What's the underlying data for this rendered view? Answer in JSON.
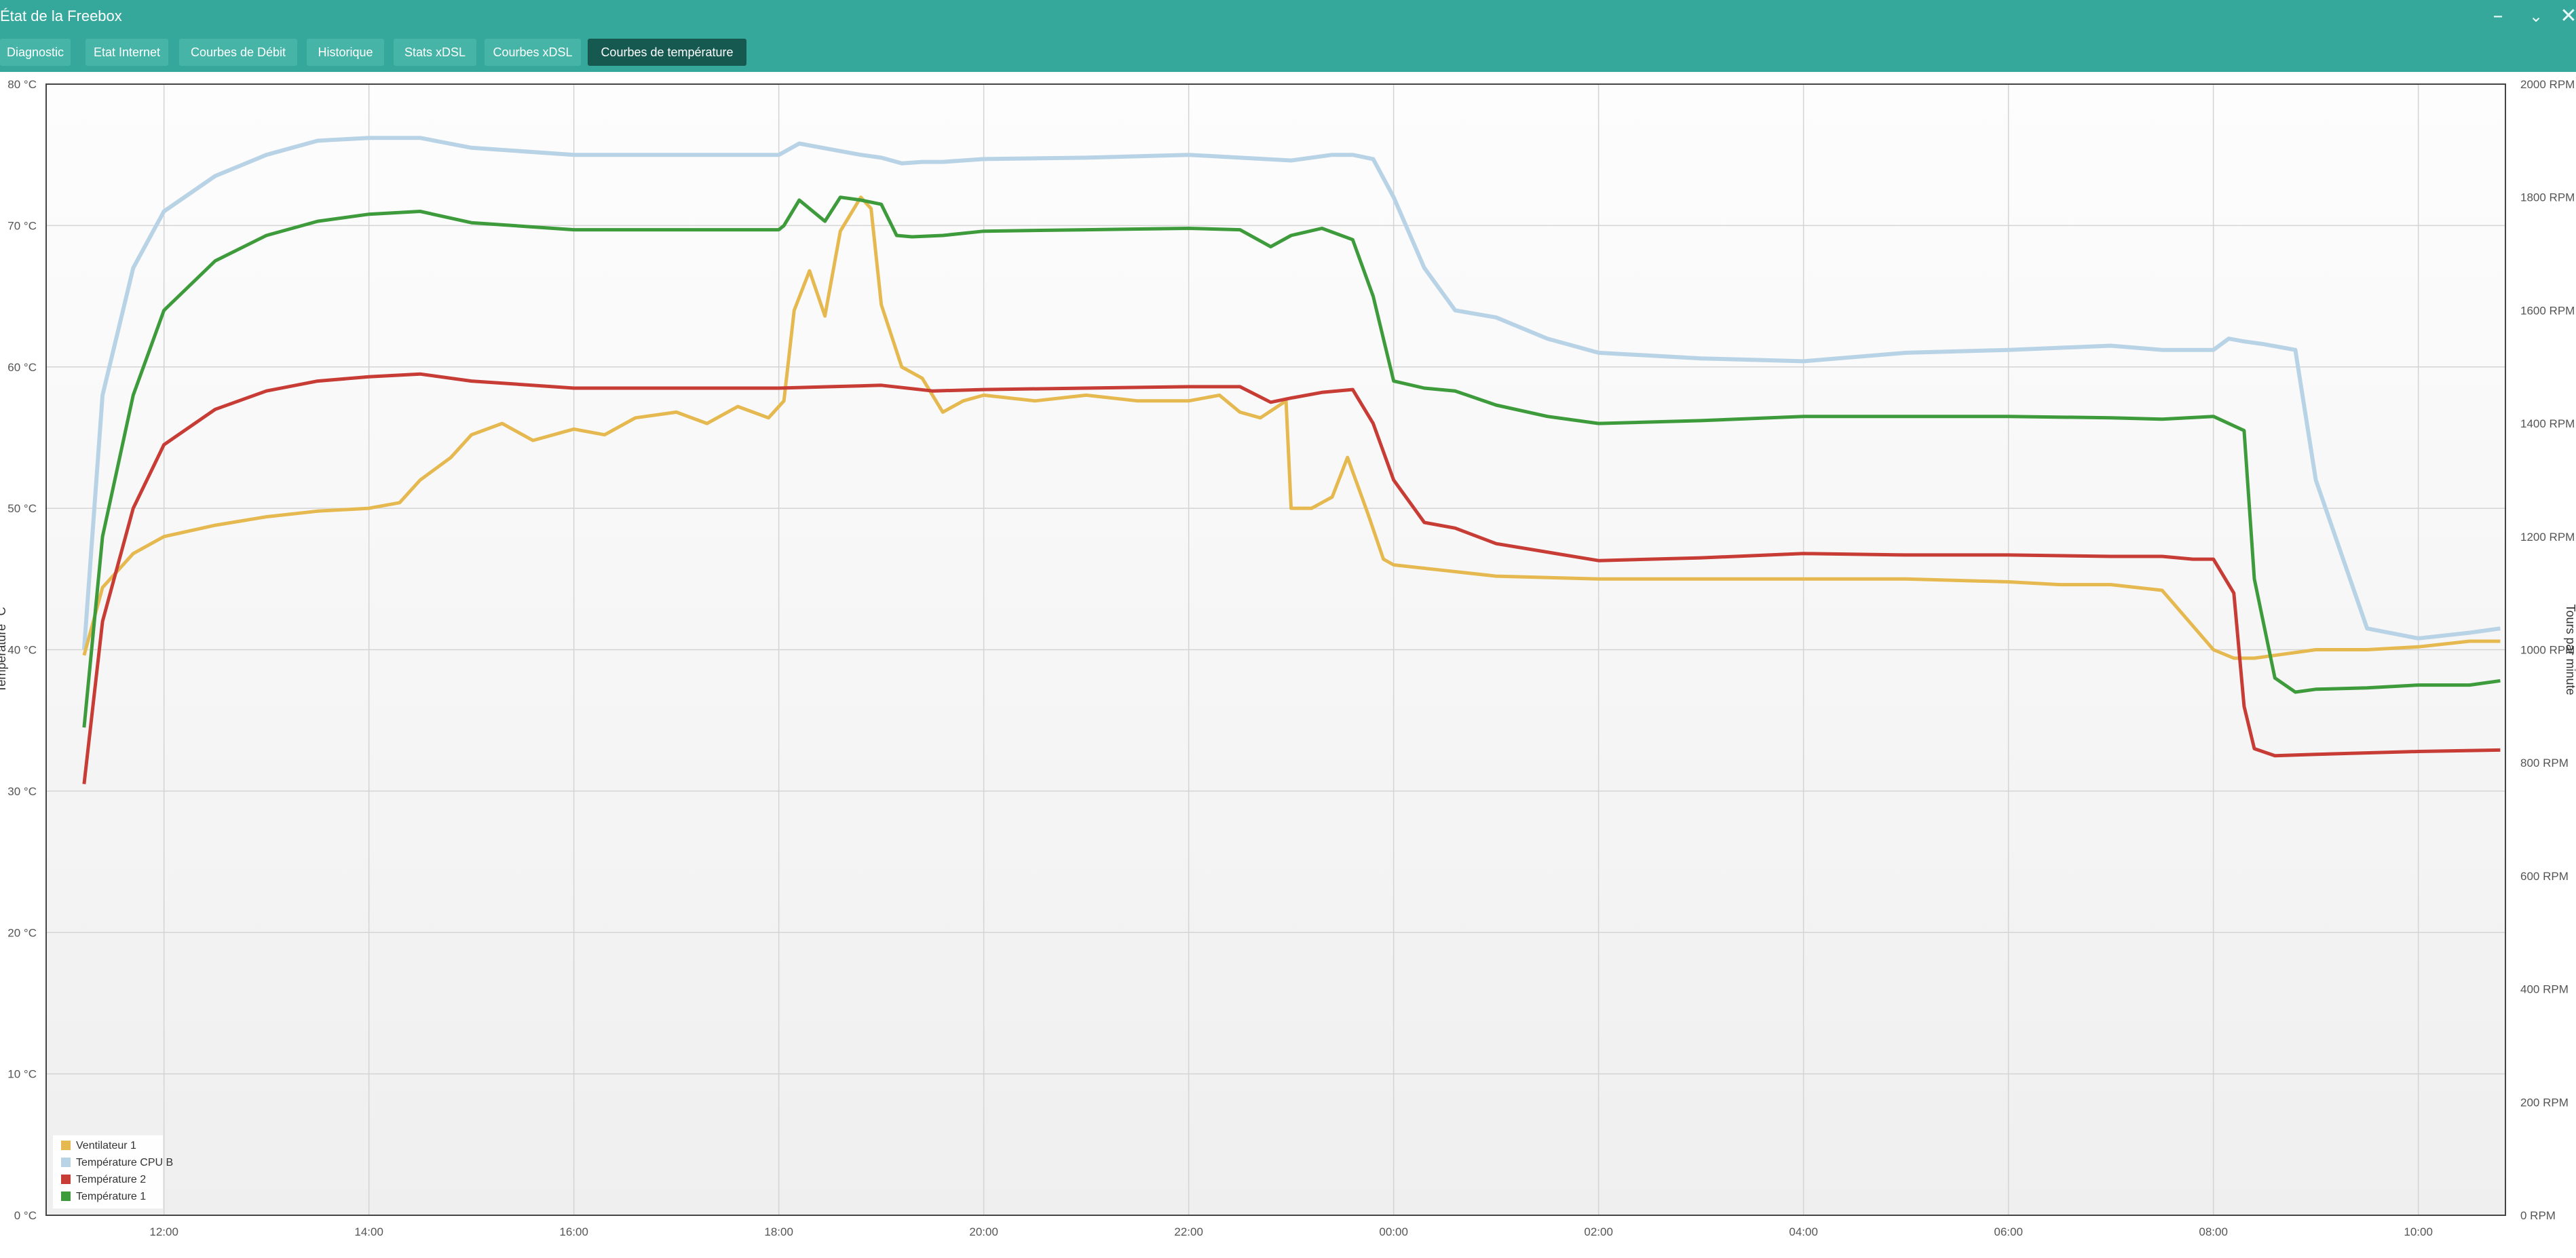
{
  "window": {
    "title": "État de la Freebox",
    "minimize_icon": "minimize-icon",
    "restore_icon": "restore-icon",
    "close_icon": "close-icon"
  },
  "tabs": [
    {
      "label": "Diagnostic",
      "active": false
    },
    {
      "label": "Etat Internet",
      "active": false
    },
    {
      "label": "Courbes de Débit",
      "active": false
    },
    {
      "label": "Historique",
      "active": false
    },
    {
      "label": "Stats xDSL",
      "active": false
    },
    {
      "label": "Courbes xDSL",
      "active": false
    },
    {
      "label": "Courbes de température",
      "active": true
    }
  ],
  "colors": {
    "header_bg": "#35a89b",
    "tab_bg": "#46b4a7",
    "tab_active_bg": "#165951",
    "ventilateur": "#e5b94f",
    "cpu_b": "#b9d3e6",
    "temp2": "#c83c36",
    "temp1": "#3e9b3c"
  },
  "chart_data": {
    "type": "line",
    "title": "",
    "ylabel": "Température °C",
    "y2label": "Tours par minute",
    "ylim": [
      0,
      80
    ],
    "y2lim": [
      0,
      2000
    ],
    "y_ticks": [
      "0 °C",
      "10 °C",
      "20 °C",
      "30 °C",
      "40 °C",
      "50 °C",
      "60 °C",
      "70 °C",
      "80 °C"
    ],
    "y2_ticks": [
      "0 RPM",
      "200 RPM",
      "400 RPM",
      "600 RPM",
      "800 RPM",
      "1000 RPM",
      "1200 RPM",
      "1400 RPM",
      "1600 RPM",
      "1800 RPM",
      "2000 RPM"
    ],
    "x_ticks": [
      "12:00",
      "14:00",
      "16:00",
      "18:00",
      "20:00",
      "22:00",
      "00:00",
      "02:00",
      "04:00",
      "06:00",
      "08:00",
      "10:00"
    ],
    "x_unit": "hours since 12:00 (first day)",
    "xlim": [
      -1.15,
      22.85
    ],
    "grid": true,
    "legend_position": "bottom-left",
    "series": [
      {
        "name": "Ventilateur 1",
        "color": "#e5b94f",
        "axis": "right",
        "x": [
          -0.78,
          -0.6,
          -0.3,
          0,
          0.5,
          1,
          1.5,
          2,
          2.3,
          2.5,
          2.8,
          3,
          3.3,
          3.6,
          4,
          4.3,
          4.6,
          5,
          5.3,
          5.6,
          5.9,
          6.05,
          6.15,
          6.3,
          6.45,
          6.6,
          6.8,
          6.9,
          7,
          7.2,
          7.4,
          7.6,
          7.8,
          8,
          8.5,
          9,
          9.5,
          10,
          10.3,
          10.5,
          10.7,
          10.95,
          11,
          11.2,
          11.4,
          11.55,
          11.75,
          11.9,
          12,
          12.5,
          13,
          14,
          15,
          16,
          17,
          18,
          18.5,
          19,
          19.5,
          20,
          20.2,
          20.4,
          20.6,
          20.8,
          21,
          21.5,
          22,
          22.5,
          22.8
        ],
        "y": [
          990,
          1110,
          1170,
          1200,
          1220,
          1235,
          1245,
          1250,
          1260,
          1300,
          1340,
          1380,
          1400,
          1370,
          1390,
          1380,
          1410,
          1420,
          1400,
          1430,
          1410,
          1440,
          1600,
          1670,
          1590,
          1740,
          1800,
          1780,
          1610,
          1500,
          1480,
          1420,
          1440,
          1450,
          1440,
          1450,
          1440,
          1440,
          1450,
          1420,
          1410,
          1440,
          1250,
          1250,
          1270,
          1340,
          1240,
          1160,
          1150,
          1140,
          1130,
          1125,
          1125,
          1125,
          1125,
          1120,
          1115,
          1115,
          1105,
          1000,
          985,
          985,
          990,
          995,
          1000,
          1000,
          1005,
          1015,
          1015
        ]
      },
      {
        "name": "Température CPU B",
        "color": "#b9d3e6",
        "axis": "left",
        "x": [
          -0.78,
          -0.6,
          -0.3,
          0,
          0.5,
          1,
          1.5,
          2,
          2.5,
          3,
          4,
          5,
          5.5,
          6,
          6.2,
          6.5,
          6.8,
          7,
          7.2,
          7.4,
          7.6,
          8,
          9,
          10,
          10.5,
          11,
          11.4,
          11.6,
          11.8,
          12,
          12.3,
          12.6,
          13,
          13.5,
          14,
          15,
          16,
          17,
          18,
          19,
          19.5,
          20,
          20.15,
          20.3,
          20.5,
          20.8,
          21,
          21.5,
          22,
          22.5,
          22.8
        ],
        "y": [
          40,
          58,
          67,
          71,
          73.5,
          75,
          76,
          76.2,
          76.2,
          75.5,
          75,
          75,
          75,
          75,
          75.8,
          75.4,
          75,
          74.8,
          74.4,
          74.5,
          74.5,
          74.7,
          74.8,
          75,
          74.8,
          74.6,
          75,
          75,
          74.7,
          72,
          67,
          64,
          63.5,
          62,
          61,
          60.6,
          60.4,
          61,
          61.2,
          61.5,
          61.2,
          61.2,
          62,
          61.8,
          61.6,
          61.2,
          52,
          41.5,
          40.8,
          41.2,
          41.5
        ]
      },
      {
        "name": "Température 2",
        "color": "#c83c36",
        "axis": "left",
        "x": [
          -0.78,
          -0.6,
          -0.3,
          0,
          0.5,
          1,
          1.5,
          2,
          2.5,
          3,
          4,
          5,
          6,
          6.5,
          7,
          7.5,
          8,
          9,
          10,
          10.5,
          10.8,
          11,
          11.3,
          11.6,
          11.8,
          12,
          12.3,
          12.6,
          13,
          14,
          15,
          16,
          17,
          18,
          19,
          19.5,
          19.8,
          20,
          20.2,
          20.3,
          20.4,
          20.6,
          21,
          22,
          22.8
        ],
        "y": [
          30.5,
          42,
          50,
          54.5,
          57,
          58.3,
          59,
          59.3,
          59.5,
          59,
          58.5,
          58.5,
          58.5,
          58.6,
          58.7,
          58.3,
          58.4,
          58.5,
          58.6,
          58.6,
          57.5,
          57.8,
          58.2,
          58.4,
          56,
          52,
          49,
          48.6,
          47.5,
          46.3,
          46.5,
          46.8,
          46.7,
          46.7,
          46.6,
          46.6,
          46.4,
          46.4,
          44,
          36,
          33,
          32.5,
          32.6,
          32.8,
          32.9
        ]
      },
      {
        "name": "Température 1",
        "color": "#3e9b3c",
        "axis": "left",
        "x": [
          -0.78,
          -0.6,
          -0.3,
          0,
          0.5,
          1,
          1.5,
          2,
          2.5,
          3,
          4,
          5,
          6,
          6.05,
          6.2,
          6.45,
          6.6,
          6.8,
          7,
          7.15,
          7.3,
          7.6,
          8,
          9,
          10,
          10.5,
          10.8,
          11,
          11.3,
          11.6,
          11.8,
          12,
          12.3,
          12.6,
          13,
          13.5,
          14,
          15,
          16,
          17,
          18,
          19,
          19.5,
          20,
          20.3,
          20.4,
          20.6,
          20.8,
          21,
          21.5,
          22,
          22.5,
          22.8
        ],
        "y": [
          34.5,
          48,
          58,
          64,
          67.5,
          69.3,
          70.3,
          70.8,
          71,
          70.2,
          69.7,
          69.7,
          69.7,
          70,
          71.8,
          70.3,
          72,
          71.8,
          71.5,
          69.3,
          69.2,
          69.3,
          69.6,
          69.7,
          69.8,
          69.7,
          68.5,
          69.3,
          69.8,
          69,
          65,
          59,
          58.5,
          58.3,
          57.3,
          56.5,
          56,
          56.2,
          56.5,
          56.5,
          56.5,
          56.4,
          56.3,
          56.5,
          55.5,
          45,
          38,
          37,
          37.2,
          37.3,
          37.5,
          37.5,
          37.8
        ]
      }
    ]
  }
}
